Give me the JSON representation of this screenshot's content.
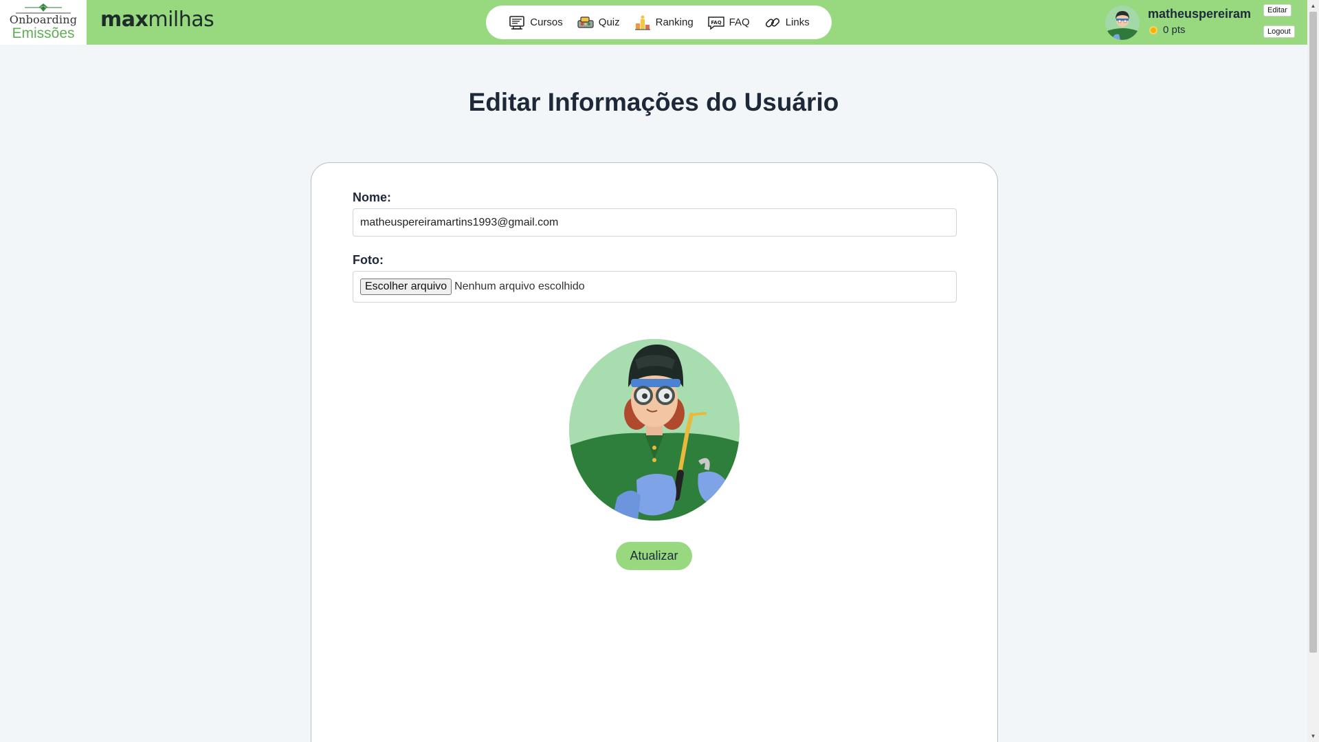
{
  "logo": {
    "line1": "Onboarding",
    "line2": "Emissões"
  },
  "brand": {
    "part1": "max",
    "part2": "milhas"
  },
  "nav": {
    "items": [
      {
        "label": "Cursos",
        "icon": "courses-icon"
      },
      {
        "label": "Quiz",
        "icon": "quiz-icon"
      },
      {
        "label": "Ranking",
        "icon": "ranking-icon"
      },
      {
        "label": "FAQ",
        "icon": "faq-icon"
      },
      {
        "label": "Links",
        "icon": "links-icon"
      }
    ]
  },
  "user": {
    "name": "matheuspereiram",
    "points": "0 pts",
    "edit_label": "Editar",
    "logout_label": "Logout"
  },
  "page": {
    "title": "Editar Informações do Usuário"
  },
  "form": {
    "name_label": "Nome:",
    "name_value": "matheuspereiramartins1993@gmail.com",
    "photo_label": "Foto:",
    "file_button": "Escolher arquivo",
    "file_status": "Nenhum arquivo escolhido",
    "submit_label": "Atualizar"
  },
  "colors": {
    "header_bg": "#98d980",
    "page_bg": "#f3f6f9",
    "accent": "#98d980",
    "title": "#1d2939"
  }
}
